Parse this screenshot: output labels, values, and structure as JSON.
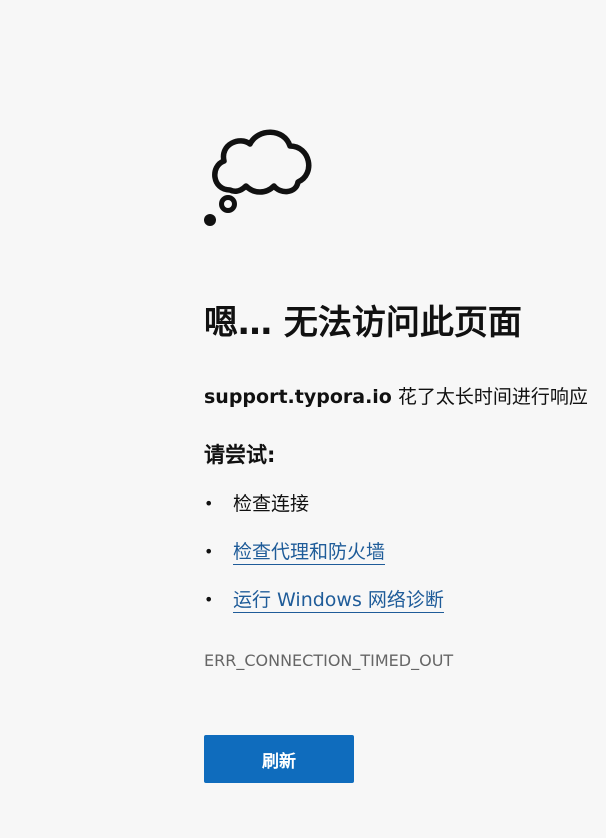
{
  "icon": {
    "name": "thought-cloud-icon"
  },
  "heading": "嗯… 无法访问此页面",
  "message": {
    "host": "support.typora.io",
    "text": " 花了太长时间进行响应"
  },
  "try_label": "请尝试:",
  "suggestions": [
    {
      "label": "检查连接",
      "is_link": false
    },
    {
      "label": "检查代理和防火墙",
      "is_link": true
    },
    {
      "label": "运行 Windows 网络诊断",
      "is_link": true
    }
  ],
  "bullet": "•",
  "error_code": "ERR_CONNECTION_TIMED_OUT",
  "refresh_button": "刷新",
  "colors": {
    "background": "#f7f7f7",
    "link": "#1f5c99",
    "button": "#0f6cbd",
    "error_code": "#666666"
  }
}
